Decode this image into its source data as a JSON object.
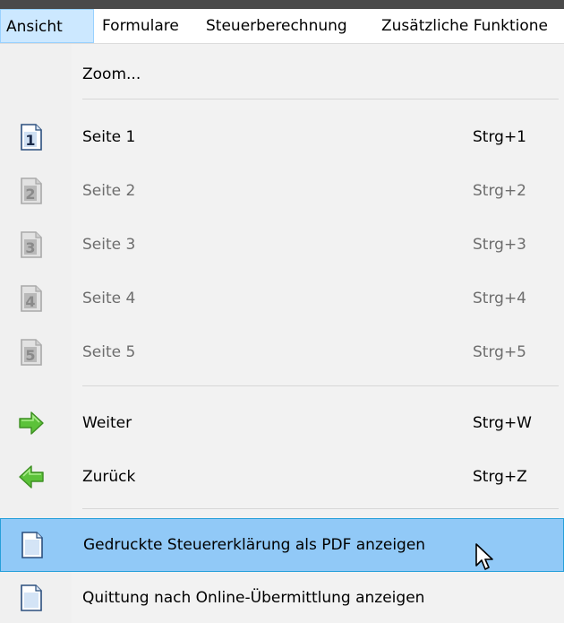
{
  "menubar": {
    "items": [
      {
        "label": "Ansicht",
        "active": true
      },
      {
        "label": "Formulare"
      },
      {
        "label": "Steuerberechnung"
      },
      {
        "label": "Zusätzliche Funktione"
      }
    ]
  },
  "menu": {
    "zoom": {
      "label": "Zoom..."
    },
    "pages": [
      {
        "label": "Seite 1",
        "shortcut": "Strg+1",
        "icon": "page-1-icon",
        "digit": "1",
        "enabled": true
      },
      {
        "label": "Seite 2",
        "shortcut": "Strg+2",
        "icon": "page-2-icon",
        "digit": "2",
        "enabled": false
      },
      {
        "label": "Seite 3",
        "shortcut": "Strg+3",
        "icon": "page-3-icon",
        "digit": "3",
        "enabled": false
      },
      {
        "label": "Seite 4",
        "shortcut": "Strg+4",
        "icon": "page-4-icon",
        "digit": "4",
        "enabled": false
      },
      {
        "label": "Seite 5",
        "shortcut": "Strg+5",
        "icon": "page-5-icon",
        "digit": "5",
        "enabled": false
      }
    ],
    "weiter": {
      "label": "Weiter",
      "shortcut": "Strg+W",
      "icon": "arrow-right-icon"
    },
    "zurueck": {
      "label": "Zurück",
      "shortcut": "Strg+Z",
      "icon": "arrow-left-icon"
    },
    "pdf": {
      "label": "Gedruckte Steuererklärung als PDF anzeigen",
      "icon": "document-icon",
      "highlighted": true
    },
    "quittung": {
      "label": "Quittung nach Online-Übermittlung anzeigen",
      "icon": "document-icon"
    }
  },
  "colors": {
    "highlight": "#91c9f7",
    "active_menu": "#cce8ff",
    "arrow_green": "#5cc23a"
  }
}
